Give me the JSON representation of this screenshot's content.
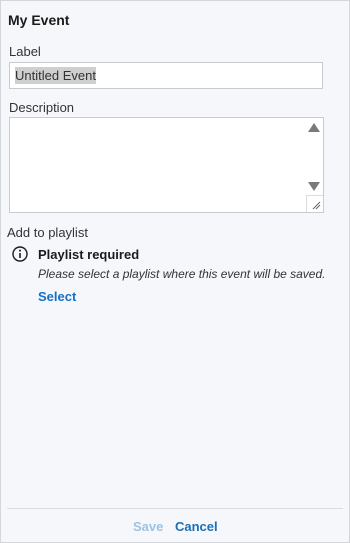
{
  "dialog": {
    "title": "My Event"
  },
  "label_field": {
    "label": "Label",
    "value": "Untitled Event"
  },
  "description_field": {
    "label": "Description",
    "value": ""
  },
  "playlist": {
    "heading": "Add to playlist",
    "notice_title": "Playlist required",
    "notice_message": "Please select a playlist where this event will be saved.",
    "select_label": "Select",
    "icon": "info-circle-icon"
  },
  "footer": {
    "save_label": "Save",
    "cancel_label": "Cancel"
  },
  "colors": {
    "accent": "#1472c4",
    "save_disabled": "#9cc3e6",
    "panel_bg": "#f5f7fa"
  }
}
